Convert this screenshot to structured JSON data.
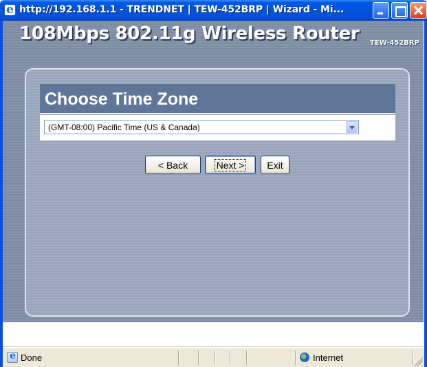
{
  "window": {
    "title": "http://192.168.1.1 - TRENDNET | TEW-452BRP | Wizard - Mi...",
    "controls": [
      "minimize-icon",
      "maximize-icon",
      "close-icon"
    ]
  },
  "header": {
    "product_title": "108Mbps 802.11g Wireless Router",
    "model": "TEW-452BRP"
  },
  "wizard": {
    "section_title": "Choose Time Zone",
    "timezone_selected": "(GMT-08:00) Pacific Time (US & Canada)",
    "buttons": {
      "back": "< Back",
      "next": "Next >",
      "exit": "Exit"
    }
  },
  "statusbar": {
    "status": "Done",
    "zone": "Internet"
  },
  "colors": {
    "titlebar": "#0054dc",
    "section_header": "#5f7698",
    "page_background": "#7d8ba3",
    "panel_background": "#97a4ba"
  }
}
